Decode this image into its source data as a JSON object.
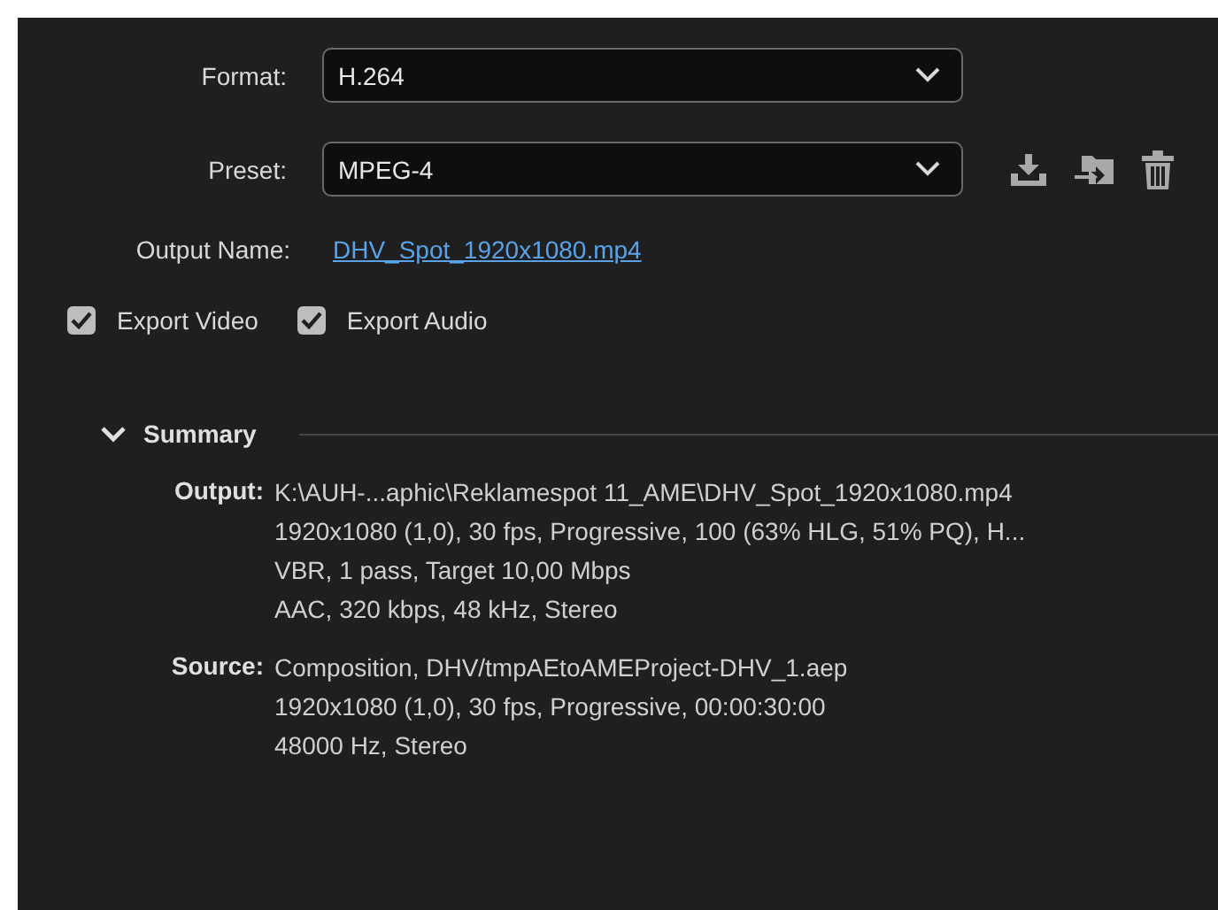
{
  "format": {
    "label": "Format:",
    "value": "H.264"
  },
  "preset": {
    "label": "Preset:",
    "value": "MPEG-4"
  },
  "output_name": {
    "label": "Output Name:",
    "value": "DHV_Spot_1920x1080.mp4"
  },
  "checkboxes": [
    {
      "label": "Export Video",
      "checked": true
    },
    {
      "label": "Export Audio",
      "checked": true
    }
  ],
  "summary": {
    "title": "Summary",
    "expanded": true,
    "sections": [
      {
        "label": "Output:",
        "lines": [
          "K:\\AUH-...aphic\\Reklamespot 11_AME\\DHV_Spot_1920x1080.mp4",
          "1920x1080 (1,0), 30 fps, Progressive, 100 (63% HLG, 51% PQ), H...",
          "VBR, 1 pass, Target 10,00 Mbps",
          "AAC, 320 kbps, 48 kHz, Stereo"
        ]
      },
      {
        "label": "Source:",
        "lines": [
          "Composition, DHV/tmpAEtoAMEProject-DHV_1.aep",
          "1920x1080 (1,0), 30 fps, Progressive, 00:00:30:00",
          "48000 Hz, Stereo"
        ]
      }
    ]
  }
}
